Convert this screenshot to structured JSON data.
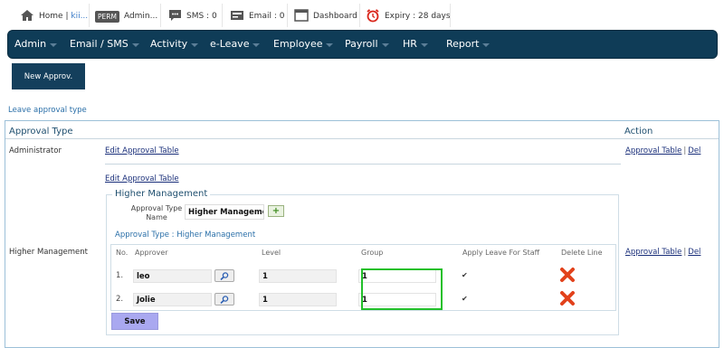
{
  "topbar": {
    "home_label": "Home |",
    "home_user": "kii...",
    "perm_badge": "PERM",
    "admin_label": "Admin...",
    "sms_label": "SMS : 0",
    "email_label": "Email : 0",
    "dashboard_label": "Dashboard",
    "expiry_label": "Expiry : 28 days"
  },
  "nav": {
    "items": [
      "Admin",
      "Email / SMS",
      "Activity",
      "e-Leave",
      "Employee",
      "Payroll",
      "HR",
      "Report"
    ]
  },
  "new_button": "New Approv.",
  "breadcrumb": "Leave approval type",
  "table": {
    "header_type": "Approval Type",
    "header_action": "Action",
    "edit_link": "Edit Approval Table",
    "approval_table_link": "Approval Table",
    "del_link": "Del",
    "pipe": "|",
    "rows": [
      {
        "type": "Administrator"
      },
      {
        "type": "Higher Management"
      }
    ]
  },
  "editor": {
    "title": "Higher Management",
    "type_name_label_1": "Approval Type",
    "type_name_label_2": "Name",
    "type_name_value": "Higher Managemen",
    "add_icon_glyph": "+",
    "subtitle": "Approval Type : Higher Management",
    "columns": {
      "no": "No.",
      "approver": "Approver",
      "level": "Level",
      "group": "Group",
      "apply": "Apply Leave For Staff",
      "delete": "Delete Line"
    },
    "lines": [
      {
        "no": "1.",
        "approver": "leo",
        "level": "1",
        "group": "1",
        "apply_check": "✔"
      },
      {
        "no": "2.",
        "approver": "Jolie",
        "level": "1",
        "group": "1",
        "apply_check": "✔"
      }
    ],
    "save_label": "Save"
  },
  "colors": {
    "nav_bg": "#0f3c57",
    "highlight": "#22c02a",
    "save_bg": "#a9a8f0",
    "delete_red": "#e2421c"
  }
}
